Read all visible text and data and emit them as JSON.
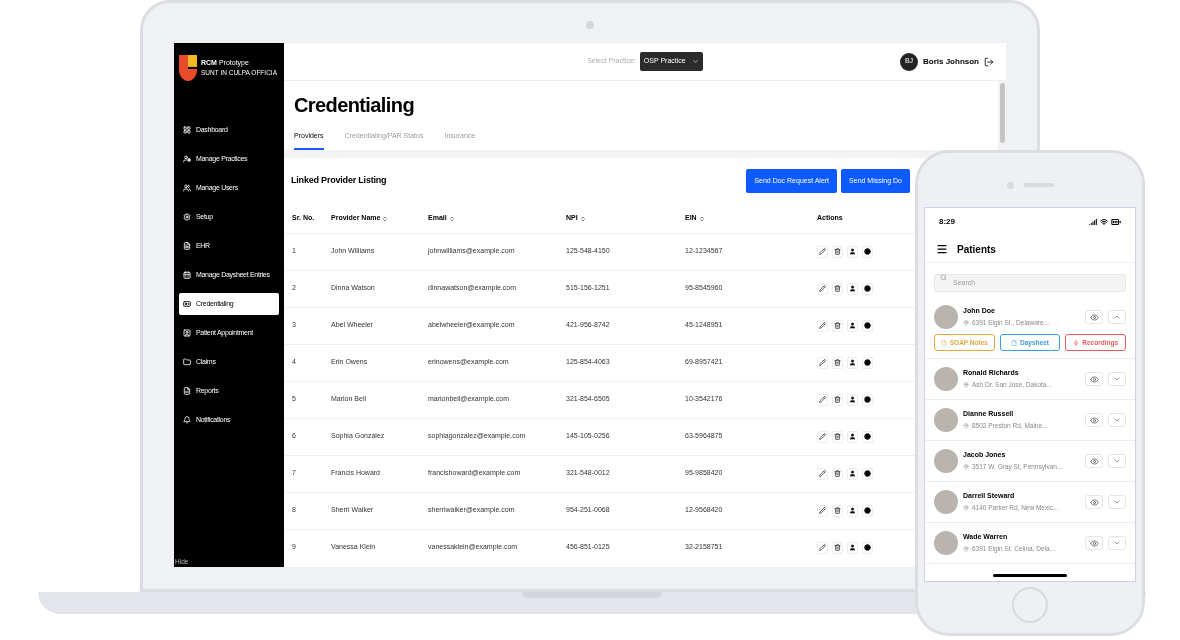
{
  "laptop_app": {
    "sidebar": {
      "logo_title": "**RCM** Prototype",
      "logo_subtitle": "SUNT IN CULPA OFFICIA",
      "items": [
        {
          "label": "Dashboard",
          "selected": false
        },
        {
          "label": "Manage Practices",
          "selected": false
        },
        {
          "label": "Manage Users",
          "selected": false
        },
        {
          "label": "Setup",
          "selected": false
        },
        {
          "label": "EHR",
          "selected": false
        },
        {
          "label": "Manage Daysheet Entries",
          "selected": false
        },
        {
          "label": "Credentialing",
          "selected": true
        },
        {
          "label": "Patient Appointment",
          "selected": false
        },
        {
          "label": "Claims",
          "selected": false
        },
        {
          "label": "Reports",
          "selected": false
        },
        {
          "label": "Notifications",
          "selected": false
        }
      ],
      "hide_label": "Hide"
    },
    "header": {
      "select_label": "Select Practice:",
      "practice": "OSP Practice",
      "user_initials": "BJ",
      "user_name": "Boris Johnson"
    },
    "page_title": "Credentialing",
    "tabs": [
      {
        "label": "Providers",
        "selected": true
      },
      {
        "label": "Credentialing/PAR Status",
        "selected": false
      },
      {
        "label": "Insurance",
        "selected": false
      }
    ],
    "section_title": "Linked Provider Listing",
    "buttons": [
      "Send Doc Request Alert",
      "Send Missing Do"
    ],
    "table": {
      "columns": [
        {
          "label": "Sr. No.",
          "sortable": false
        },
        {
          "label": "Provider Name",
          "sortable": true
        },
        {
          "label": "Email",
          "sortable": true
        },
        {
          "label": "NPI",
          "sortable": true
        },
        {
          "label": "EIN",
          "sortable": true
        },
        {
          "label": "Actions",
          "sortable": false
        }
      ],
      "rows": [
        [
          "1",
          "John Williams",
          "johnwilliams@example.com",
          "125-548-4150",
          "12-1234567"
        ],
        [
          "2",
          "Dinna Watson",
          "dinnawatson@example.com",
          "515-156-1251",
          "95-8545960"
        ],
        [
          "3",
          "Abel Wheeler",
          "abelwheeler@example.com",
          "421-956-8742",
          "45-1248951"
        ],
        [
          "4",
          "Erin Owens",
          "erinowens@example.com",
          "125-854-4063",
          "69-8957421"
        ],
        [
          "5",
          "Marion Bell",
          "marionbell@example.com",
          "321-854-6505",
          "10-3542176"
        ],
        [
          "6",
          "Sophia Gonzalez",
          "sophiagonzalez@example.com",
          "145-105-0256",
          "63-5964875"
        ],
        [
          "7",
          "Francis Howard",
          "francishoward@example.com",
          "321-548-0012",
          "95-9858420"
        ],
        [
          "8",
          "Sherri Walker",
          "sherriwalker@example.com",
          "954-251-0068",
          "12-9568420"
        ],
        [
          "9",
          "Vanessa Klein",
          "vanessaklein@example.com",
          "456-851-0125",
          "32-2158751"
        ]
      ]
    }
  },
  "phone_app": {
    "time": "8:29",
    "title": "Patients",
    "search": {
      "placeholder": "Search"
    },
    "patients": [
      {
        "name": "John Doe",
        "address": "6391 Elgin St., Delaware...",
        "expanded": true,
        "actions": [
          {
            "label": "SOAP Notes",
            "kind": "document",
            "color": "#e3a740"
          },
          {
            "label": "Daysheet",
            "kind": "document",
            "color": "#3c9be3"
          },
          {
            "label": "Recordings",
            "kind": "microphone",
            "color": "#e45b5b"
          }
        ]
      },
      {
        "name": "Ronald Richards",
        "address": "Ash Dr. San Jose, Dakota...",
        "expanded": false
      },
      {
        "name": "Dianne Russell",
        "address": "8502 Preston Rd, Maine...",
        "expanded": false
      },
      {
        "name": "Jacob Jones",
        "address": "3517 W. Gray St, Pennsylvan...",
        "expanded": false
      },
      {
        "name": "Darrell Steward",
        "address": "4140 Parker Rd, New Mexic...",
        "expanded": false
      },
      {
        "name": "Wade Warren",
        "address": "6391 Elgin St. Celina, Dela...",
        "expanded": false
      }
    ]
  }
}
